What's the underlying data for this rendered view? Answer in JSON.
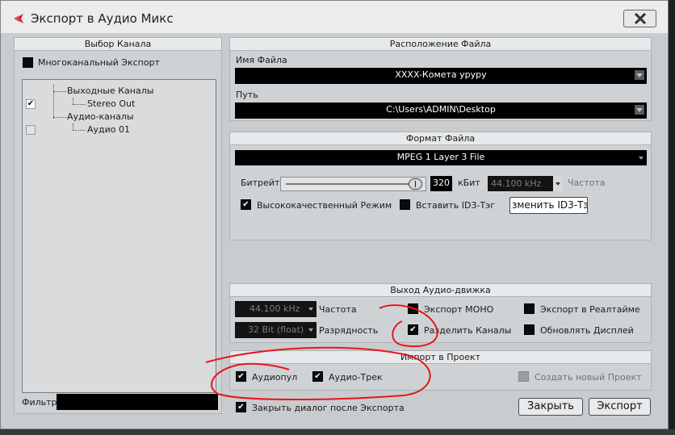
{
  "window": {
    "title": "Экспорт в Аудио Микс",
    "close_label": "✕"
  },
  "channel": {
    "header": "Выбор Канала",
    "multichannel_label": "Многоканальный Экспорт",
    "multichannel_checked": false,
    "tree": [
      {
        "label": "Выходные Каналы",
        "type": "group"
      },
      {
        "label": "Stereo Out",
        "type": "item",
        "checked": true
      },
      {
        "label": "Аудио-каналы",
        "type": "group"
      },
      {
        "label": "Аудио 01",
        "type": "item",
        "checked": false
      }
    ],
    "filter_label": "Фильтр",
    "filter_value": ""
  },
  "file_location": {
    "header": "Расположение Файла",
    "name_label": "Имя Файла",
    "name_value": "XXXX-Комета уруру",
    "path_label": "Путь",
    "path_value": "C:\\Users\\ADMIN\\Desktop"
  },
  "file_format": {
    "header": "Формат Файла",
    "format_value": "MPEG 1 Layer 3 File",
    "bitrate_label": "Битрейт",
    "bitrate_value": "320",
    "bitrate_unit": "кБит",
    "rate_value": "44.100 kHz",
    "rate_label": "Частота",
    "hq_label": "Высококачественный Режим",
    "hq_checked": true,
    "id3_insert_label": "Вставить ID3-Тэг",
    "id3_insert_checked": false,
    "id3_edit_label": "зменить ID3-Тэ"
  },
  "audio_engine": {
    "header": "Выход Аудио-движка",
    "rate_value": "44.100 kHz",
    "rate_label": "Частота",
    "depth_value": "32 Bit (float)",
    "depth_label": "Разрядность",
    "mono_label": "Экспорт МОНО",
    "mono_checked": false,
    "split_label": "Разделить Каналы",
    "split_checked": true,
    "realtime_label": "Экспорт в Реалтайме",
    "realtime_checked": false,
    "update_label": "Обновлять Дисплей",
    "update_checked": false
  },
  "import": {
    "header": "Импорт в Проект",
    "audiopool_label": "Аудиопул",
    "audiopool_checked": true,
    "audiotrack_label": "Аудио-Трек",
    "audiotrack_checked": true,
    "new_project_label": "Создать новый Проект",
    "new_project_checked": false
  },
  "footer": {
    "close_dialog_label": "Закрыть диалог после Экспорта",
    "close_dialog_checked": true,
    "close_button": "Закрыть",
    "export_button": "Экспорт"
  },
  "colors": {
    "annotation": "#e8141c",
    "app_icon": "#c8202a"
  }
}
